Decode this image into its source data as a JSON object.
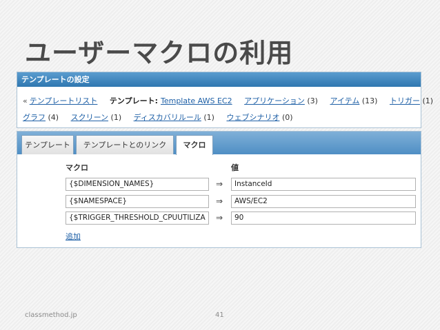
{
  "slide": {
    "title": "ユーザーマクロの利用",
    "footer_left": "classmethod.jp",
    "page_number": "41"
  },
  "panel": {
    "header": "テンプレートの設定",
    "breadcrumb_sep": "«",
    "template_list_link": "テンプレートリスト",
    "template_label": "テンプレート:",
    "template_name": "Template AWS EC2",
    "links_row1": [
      {
        "label": "アプリケーション",
        "count": "(3)"
      },
      {
        "label": "アイテム",
        "count": "(13)"
      },
      {
        "label": "トリガー",
        "count": "(1)"
      }
    ],
    "links_row2": [
      {
        "label": "グラフ",
        "count": "(4)"
      },
      {
        "label": "スクリーン",
        "count": "(1)"
      },
      {
        "label": "ディスカバリルール",
        "count": "(1)"
      },
      {
        "label": "ウェブシナリオ",
        "count": "(0)"
      }
    ]
  },
  "tabs": [
    {
      "label": "テンプレート"
    },
    {
      "label": "テンプレートとのリンク"
    },
    {
      "label": "マクロ"
    }
  ],
  "macros": {
    "macro_header": "マクロ",
    "value_header": "値",
    "arrow": "⇒",
    "rows": [
      {
        "macro": "{$DIMENSION_NAMES}",
        "value": "InstanceId"
      },
      {
        "macro": "{$NAMESPACE}",
        "value": "AWS/EC2"
      },
      {
        "macro": "{$TRIGGER_THRESHOLD_CPUUTILIZA",
        "value": "90"
      }
    ],
    "add_label": "追加"
  }
}
